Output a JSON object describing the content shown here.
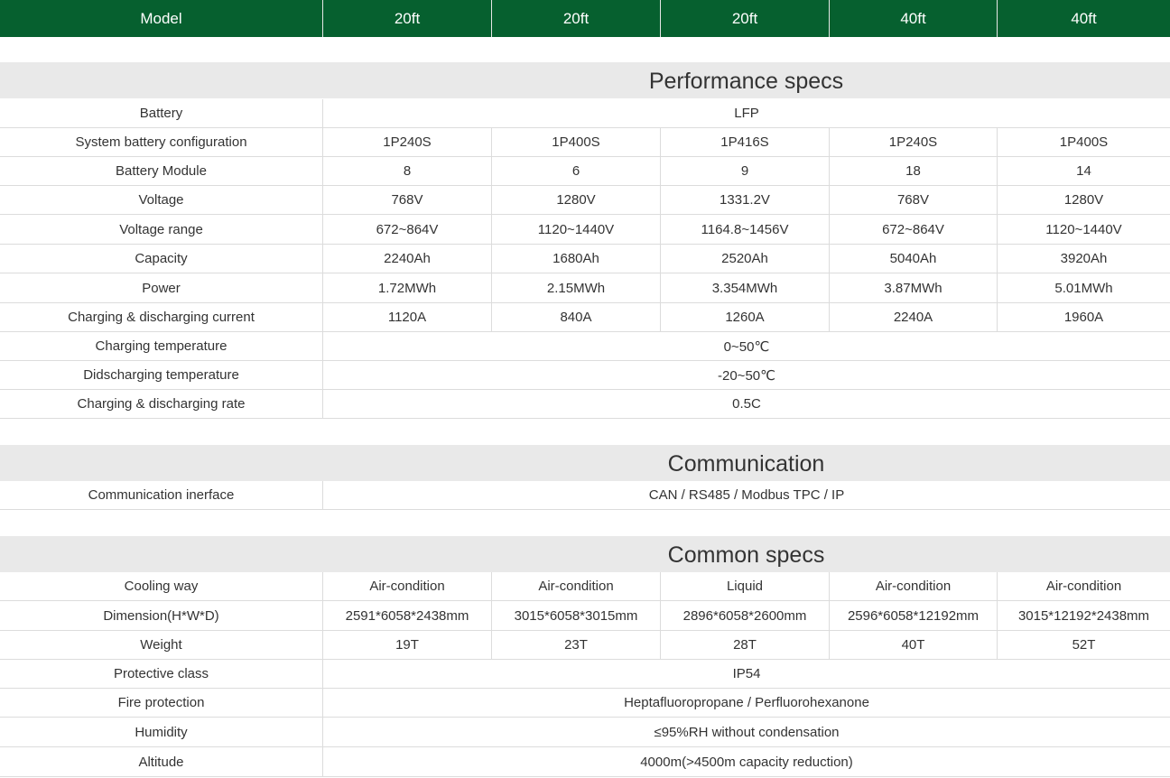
{
  "header": {
    "model_label": "Model",
    "columns": [
      "20ft",
      "20ft",
      "20ft",
      "40ft",
      "40ft"
    ]
  },
  "sections": {
    "performance": {
      "title": "Performance specs",
      "rows": [
        {
          "label": "Battery",
          "merged": "LFP"
        },
        {
          "label": "System battery configuration",
          "values": [
            "1P240S",
            "1P400S",
            "1P416S",
            "1P240S",
            "1P400S"
          ]
        },
        {
          "label": "Battery Module",
          "values": [
            "8",
            "6",
            "9",
            "18",
            "14"
          ]
        },
        {
          "label": "Voltage",
          "values": [
            "768V",
            "1280V",
            "1331.2V",
            "768V",
            "1280V"
          ]
        },
        {
          "label": "Voltage range",
          "values": [
            "672~864V",
            "1120~1440V",
            "1164.8~1456V",
            "672~864V",
            "1120~1440V"
          ]
        },
        {
          "label": "Capacity",
          "values": [
            "2240Ah",
            "1680Ah",
            "2520Ah",
            "5040Ah",
            "3920Ah"
          ]
        },
        {
          "label": "Power",
          "values": [
            "1.72MWh",
            "2.15MWh",
            "3.354MWh",
            "3.87MWh",
            "5.01MWh"
          ]
        },
        {
          "label": "Charging & discharging current",
          "values": [
            "1120A",
            "840A",
            "1260A",
            "2240A",
            "1960A"
          ]
        },
        {
          "label": "Charging temperature",
          "merged": "0~50℃"
        },
        {
          "label": "Didscharging temperature",
          "merged": "-20~50℃"
        },
        {
          "label": "Charging & discharging rate",
          "merged": "0.5C"
        }
      ]
    },
    "communication": {
      "title": "Communication",
      "rows": [
        {
          "label": "Communication inerface",
          "merged": "CAN / RS485 / Modbus TPC / IP"
        }
      ]
    },
    "common": {
      "title": "Common specs",
      "rows": [
        {
          "label": "Cooling way",
          "values": [
            "Air-condition",
            "Air-condition",
            "Liquid",
            "Air-condition",
            "Air-condition"
          ]
        },
        {
          "label": "Dimension(H*W*D)",
          "values": [
            "2591*6058*2438mm",
            "3015*6058*3015mm",
            "2896*6058*2600mm",
            "2596*6058*12192mm",
            "3015*12192*2438mm"
          ]
        },
        {
          "label": "Weight",
          "values": [
            "19T",
            "23T",
            "28T",
            "40T",
            "52T"
          ]
        },
        {
          "label": "Protective class",
          "merged": "IP54"
        },
        {
          "label": "Fire protection",
          "merged": "Heptafluoropropane / Perfluorohexanone"
        },
        {
          "label": "Humidity",
          "merged": "≤95%RH without condensation"
        },
        {
          "label": "Altitude",
          "merged": "4000m(>4500m capacity reduction)"
        }
      ]
    }
  }
}
